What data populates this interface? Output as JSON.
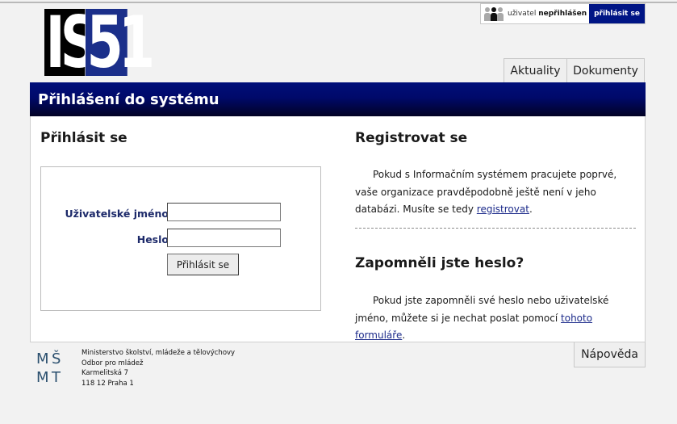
{
  "logo": {
    "part1": "IS",
    "part2": "51"
  },
  "user_box": {
    "status_prefix": "uživatel",
    "status_value": "nepřihlášen",
    "login_link": "přihlásit se"
  },
  "nav": {
    "tabs": [
      {
        "label": "Aktuality"
      },
      {
        "label": "Dokumenty"
      }
    ]
  },
  "page_title": "Přihlášení do systému",
  "login": {
    "heading": "Přihlásit se",
    "username_label": "Uživatelské jméno",
    "username_value": "",
    "password_label": "Heslo",
    "password_value": "",
    "submit_label": "Přihlásit se"
  },
  "register": {
    "heading": "Registrovat se",
    "text": "Pokud s Informačním systémem pracujete poprvé, vaše organizace pravděpodobně ještě není v jeho databázi. Musíte se tedy",
    "link": "registrovat",
    "end": "."
  },
  "forgot": {
    "heading": "Zapomněli jste heslo?",
    "text": "Pokud jste zapomněli své heslo nebo uživatelské jméno, můžete si je nechat poslat pomocí",
    "link": "tohoto formuláře",
    "end": "."
  },
  "footer": {
    "logo_letters": [
      "M",
      "Š",
      "M",
      "T"
    ],
    "lines": [
      "Ministerstvo školství, mládeže a tělovýchovy",
      "Odbor pro mládež",
      "Karmelitská 7",
      "118 12 Praha 1"
    ],
    "help_label": "Nápověda"
  },
  "colors": {
    "brand": "#001585",
    "title_bar_dark": "#020224",
    "label": "#1d2a6a"
  }
}
